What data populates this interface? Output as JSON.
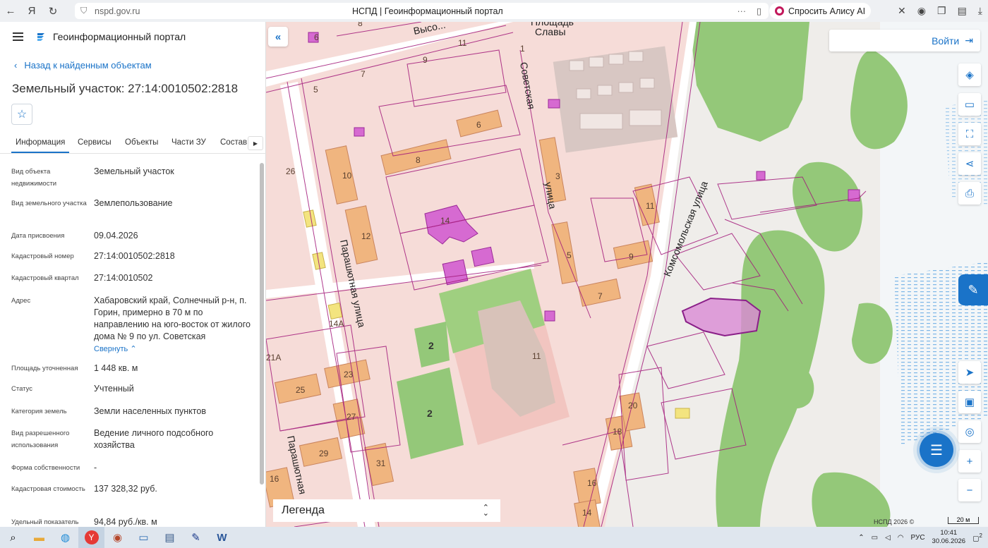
{
  "browser": {
    "url": "nspd.gov.ru",
    "tab_title": "НСПД | Геоинформационный портал",
    "alice_label": "Спросить Алису AI"
  },
  "panel": {
    "title": "Геоинформационный портал",
    "back_link": "Назад к найденным объектам",
    "object_title": "Земельный участок: 27:14:0010502:2818",
    "tabs": [
      "Информация",
      "Сервисы",
      "Объекты",
      "Части ЗУ",
      "Состав"
    ],
    "collapse_label": "Свернуть",
    "fields": [
      {
        "key": "Вид объекта недвижимости",
        "value": "Земельный участок"
      },
      {
        "key": "Вид земельного участка",
        "value": "Землепользование"
      },
      {
        "key": "Дата присвоения",
        "value": "09.04.2026"
      },
      {
        "key": "Кадастровый номер",
        "value": "27:14:0010502:2818"
      },
      {
        "key": "Кадастровый квартал",
        "value": "27:14:0010502"
      },
      {
        "key": "Адрес",
        "value": "Хабаровский край, Солнечный р-н, п. Горин, примерно в 70 м по направлению на юго-восток от жилого дома № 9 по ул. Советская"
      },
      {
        "key": "Площадь уточненная",
        "value": "1 448 кв. м"
      },
      {
        "key": "Статус",
        "value": "Учтенный"
      },
      {
        "key": "Категория земель",
        "value": "Земли населенных пунктов"
      },
      {
        "key": "Вид разрешенного использования",
        "value": "Ведение личного подсобного хозяйства"
      },
      {
        "key": "Форма собственности",
        "value": "-"
      },
      {
        "key": "Кадастровая стоимость",
        "value": "137 328,32 руб."
      },
      {
        "key": "Удельный показатель",
        "value": "94,84 руб./кв. м"
      }
    ]
  },
  "map": {
    "login_label": "Войти",
    "legend_label": "Легенда",
    "attribution": "НСПД 2026 ©",
    "scale_label": "20 м",
    "streets": [
      "Площадь Славы",
      "Советская улица",
      "Комсомольская улица",
      "Парашютная улица",
      "Высо...",
      "Парашютна..."
    ],
    "house_numbers": [
      "1",
      "2",
      "2",
      "3",
      "5",
      "6",
      "7",
      "7",
      "8",
      "9",
      "9",
      "10",
      "11",
      "11",
      "11",
      "12",
      "14",
      "14",
      "14А",
      "16",
      "16",
      "18",
      "20",
      "21А",
      "23",
      "25",
      "26",
      "27",
      "29",
      "31",
      "5",
      "6",
      "8"
    ]
  },
  "taskbar": {
    "lang": "РУС",
    "time": "10:41",
    "date": "30.06.2026",
    "notif_count": "2"
  }
}
